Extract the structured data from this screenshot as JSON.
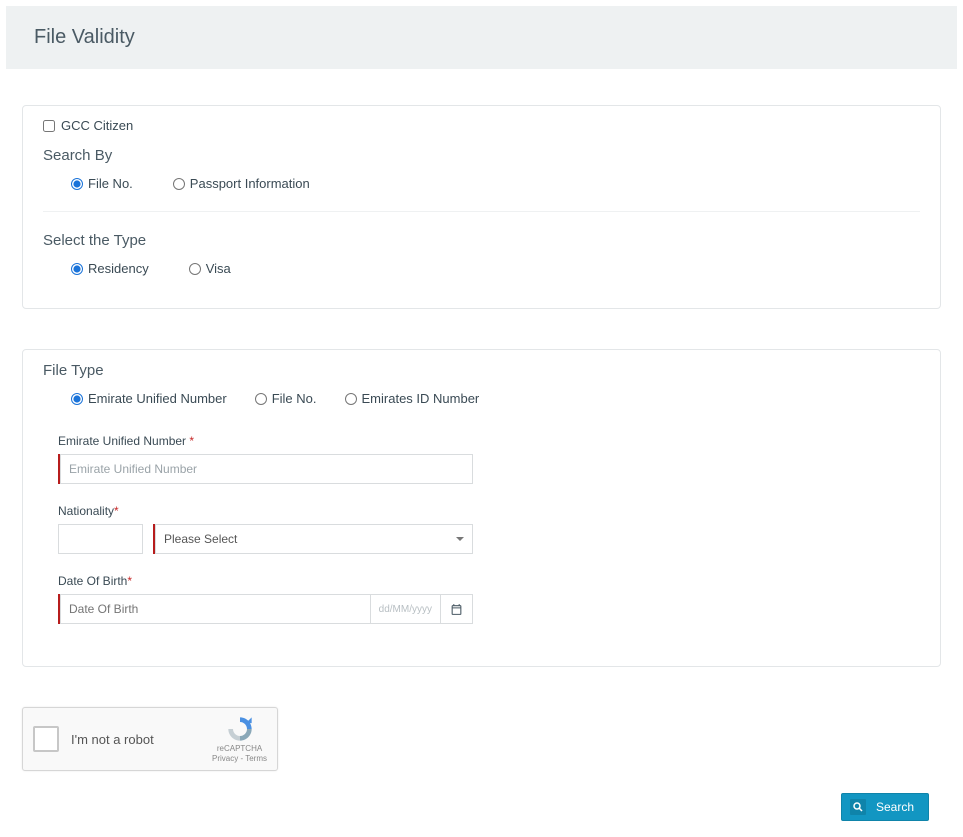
{
  "header": {
    "title": "File Validity"
  },
  "panel1": {
    "gccLabel": "GCC Citizen",
    "searchBy": {
      "heading": "Search By",
      "fileNo": "File No.",
      "passport": "Passport Information"
    },
    "selectType": {
      "heading": "Select the Type",
      "residency": "Residency",
      "visa": "Visa"
    }
  },
  "panel2": {
    "fileType": {
      "heading": "File Type",
      "eun": "Emirate Unified Number",
      "fileNo": "File No.",
      "eid": "Emirates ID Number"
    },
    "eunField": {
      "label": "Emirate Unified Number ",
      "placeholder": "Emirate Unified Number"
    },
    "nationality": {
      "label": "Nationality",
      "placeholder": "Please Select"
    },
    "dob": {
      "label": "Date Of Birth",
      "placeholder": "Date Of Birth",
      "hint": "dd/MM/yyyy"
    }
  },
  "captcha": {
    "label": "I'm not a robot",
    "brand": "reCAPTCHA",
    "legal": "Privacy - Terms"
  },
  "actions": {
    "search": "Search"
  }
}
